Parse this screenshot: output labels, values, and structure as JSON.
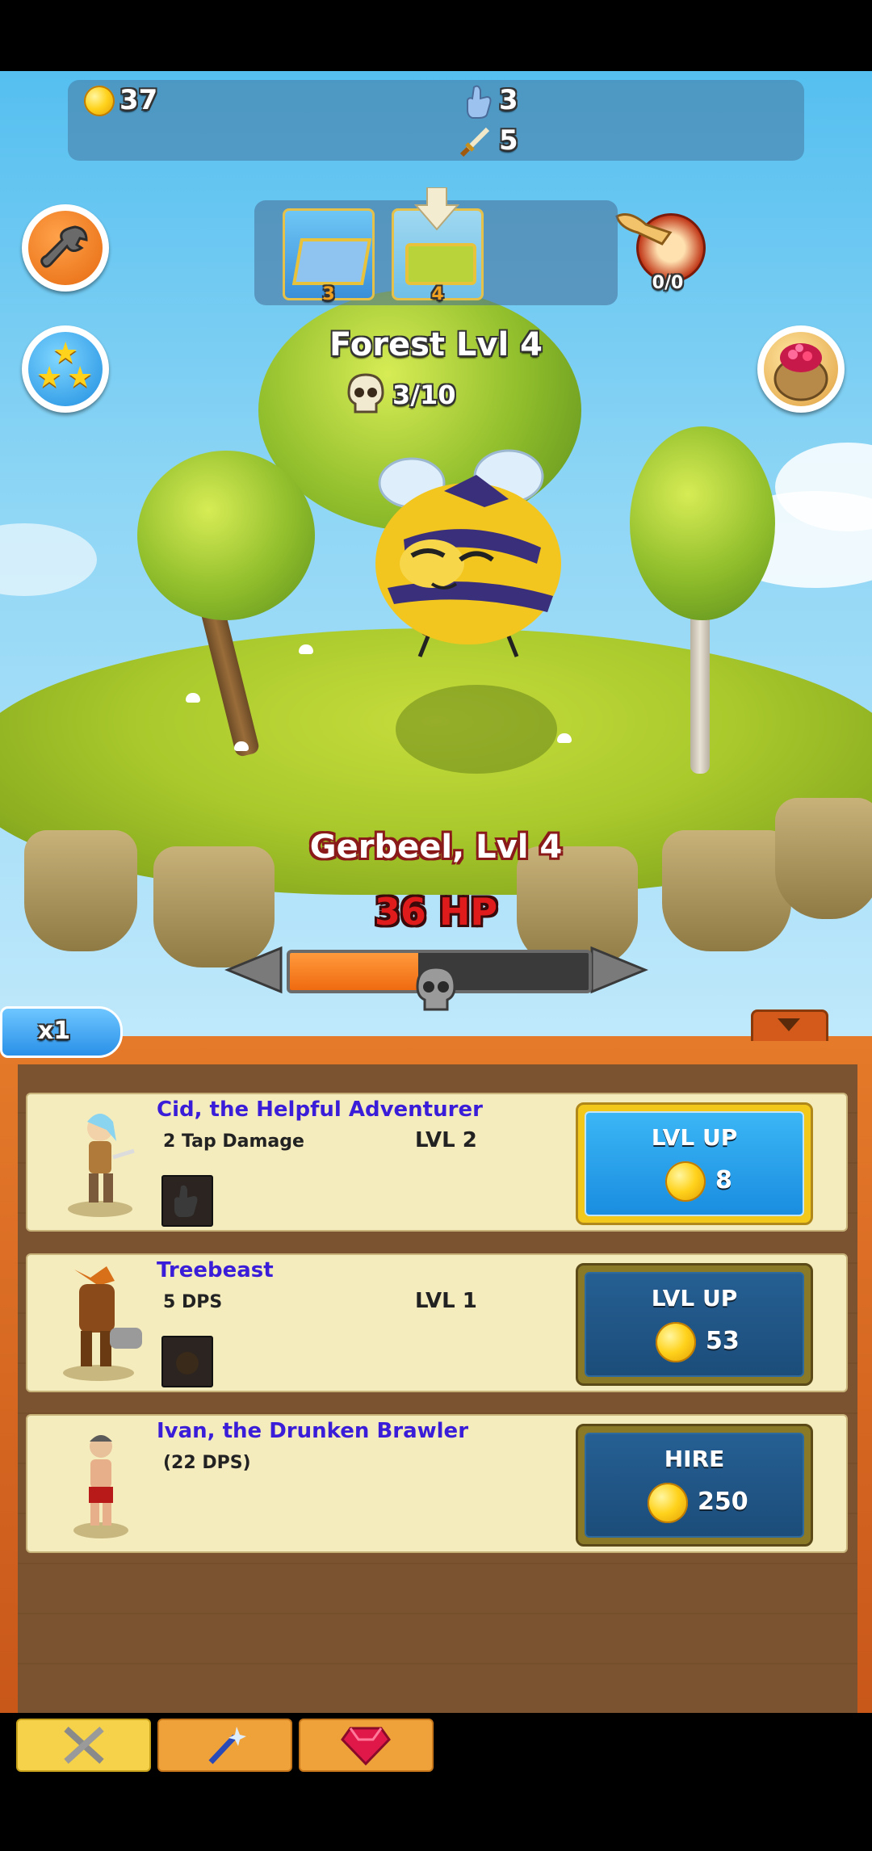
{
  "top_bar": {
    "gold": "37",
    "tap_value": "3",
    "sword_value": "5"
  },
  "zones": [
    {
      "level": "3"
    },
    {
      "level": "4"
    }
  ],
  "boss_timer": "0/0",
  "zone": {
    "title": "Forest Lvl 4",
    "kills": "3/10"
  },
  "monster": {
    "name": "Gerbeel, Lvl 4",
    "hp_label": "36 HP",
    "hp_fraction": 0.43
  },
  "multiplier": "x1",
  "heroes": [
    {
      "name": "Cid, the Helpful Adventurer",
      "stat": "2 Tap Damage",
      "level": "LVL 2",
      "button": "LVL UP",
      "cost": "8"
    },
    {
      "name": "Treebeast",
      "stat": "5 DPS",
      "level": "LVL 1",
      "button": "LVL UP",
      "cost": "53"
    },
    {
      "name": "Ivan, the Drunken Brawler",
      "stat": "(22 DPS)",
      "level": "",
      "button": "HIRE",
      "cost": "250"
    }
  ],
  "icons": {
    "settings": "wrench-icon",
    "achievements": "stars-icon",
    "relics": "ruby-bag-icon",
    "tabs": [
      "swords-icon",
      "magic-wand-icon",
      "ruby-icon"
    ]
  },
  "colors": {
    "hero_name": "#3a1dd8",
    "hp_text": "#e01b1b",
    "hp_fill": "#f06a10",
    "active_button": "#1a8de0",
    "inactive_button": "#1c4d7a"
  }
}
